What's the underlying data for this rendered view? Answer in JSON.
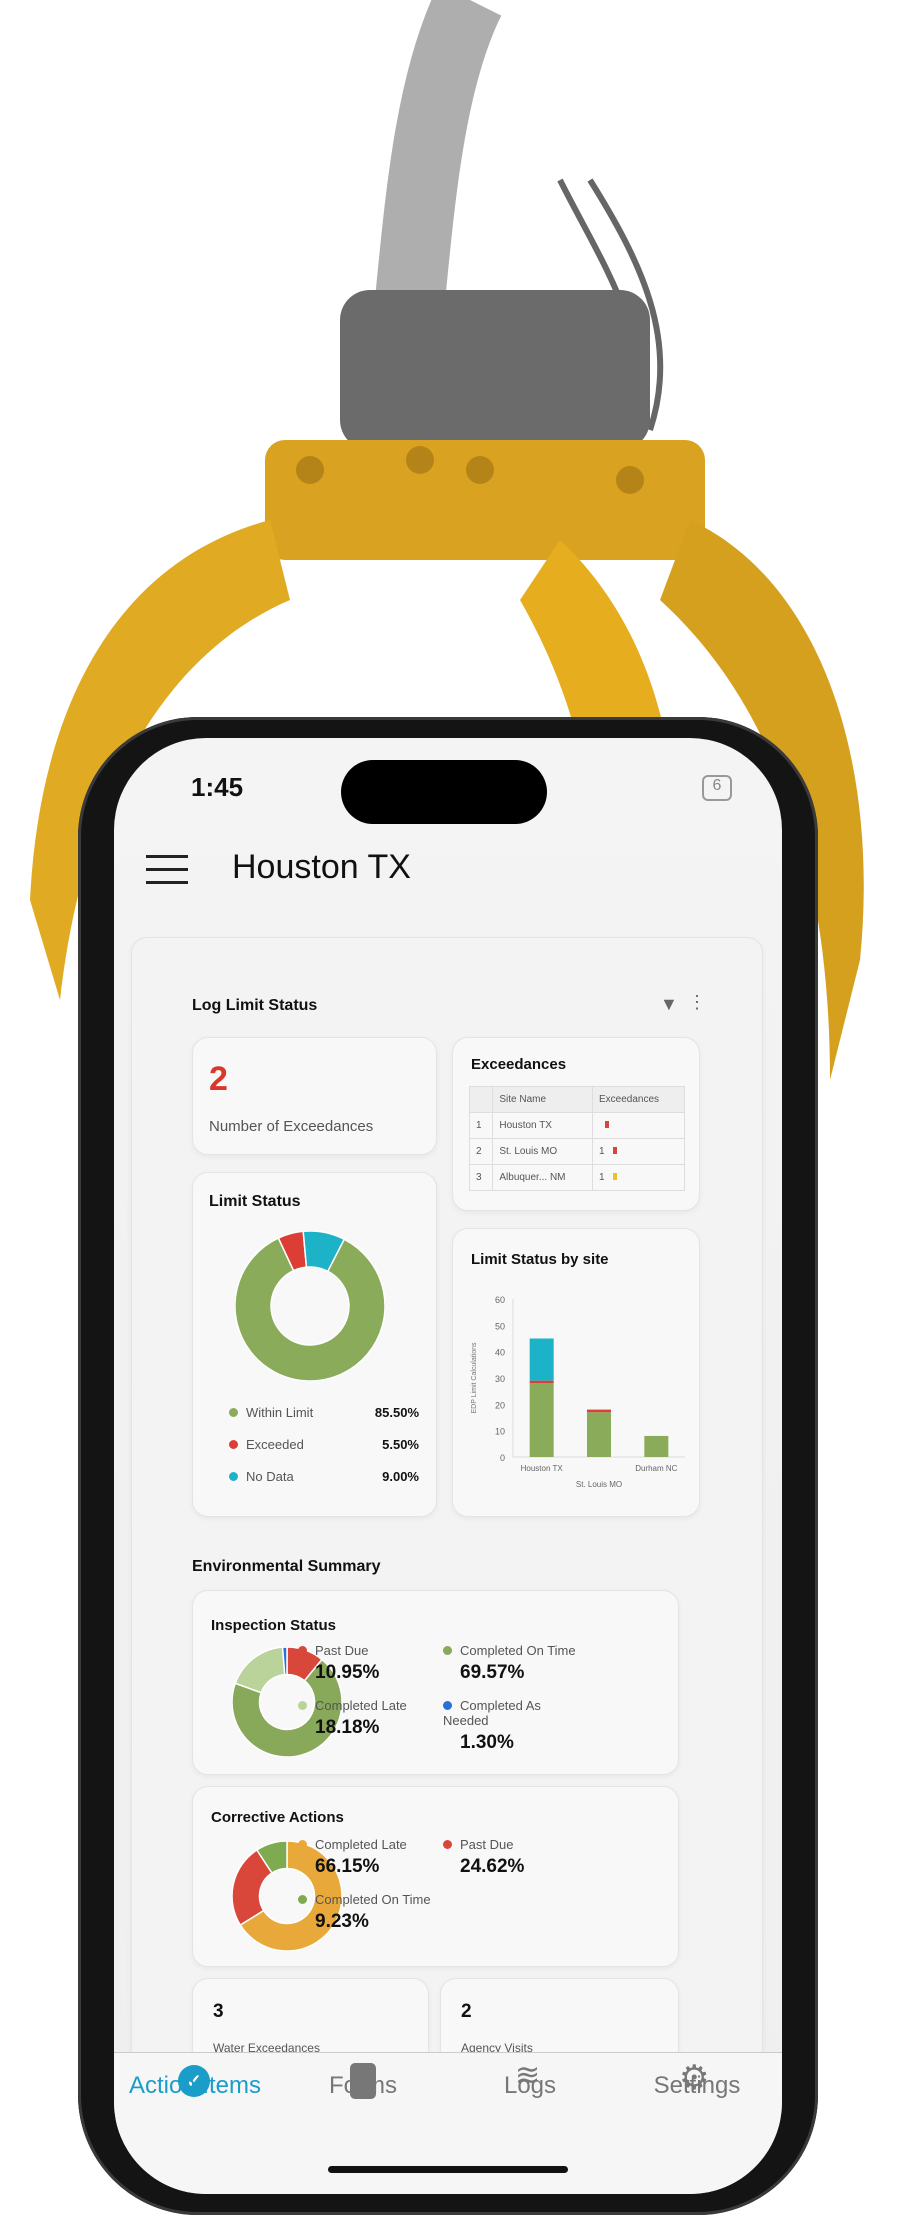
{
  "status_bar": {
    "time": "1:45",
    "battery": "6"
  },
  "header": {
    "title": "Houston TX"
  },
  "log_limit": {
    "title": "Log Limit Status",
    "exceed_count": "2",
    "exceed_label": "Number of Exceedances",
    "table": {
      "title": "Exceedances",
      "columns": [
        "",
        "Site Name",
        "Exceedances"
      ],
      "rows": [
        {
          "n": "1",
          "site": "Houston TX",
          "count": "",
          "color": "#d9453a"
        },
        {
          "n": "2",
          "site": "St. Louis MO",
          "count": "1",
          "color": "#d9453a"
        },
        {
          "n": "3",
          "site": "Albuquer... NM",
          "count": "1",
          "color": "#f0c020"
        }
      ]
    },
    "limit_status": {
      "title": "Limit Status",
      "items": [
        {
          "label": "Within Limit",
          "value": "85.50%",
          "pct": 85.5,
          "color": "#8aab5a"
        },
        {
          "label": "Exceeded",
          "value": "5.50%",
          "pct": 5.5,
          "color": "#dc3e35"
        },
        {
          "label": "No Data",
          "value": "9.00%",
          "pct": 9.0,
          "color": "#1cb3c9"
        }
      ]
    }
  },
  "chart_data": {
    "type": "bar",
    "title": "Limit Status by site",
    "ylabel": "EDP Limit Calculations",
    "ylim": [
      0,
      60
    ],
    "yticks": [
      "0",
      "10",
      "20",
      "30",
      "40",
      "50",
      "60"
    ],
    "categories": [
      "Houston TX",
      "St. Louis MO",
      "Durham NC"
    ],
    "series": [
      {
        "values": [
          28,
          17,
          8
        ],
        "color": "#8aab5a"
      },
      {
        "values": [
          1,
          1,
          0
        ],
        "color": "#dc3e35"
      },
      {
        "values": [
          16,
          0,
          0
        ],
        "color": "#1cb3c9"
      }
    ]
  },
  "env": {
    "title": "Environmental Summary",
    "inspection": {
      "title": "Inspection Status",
      "items": [
        {
          "label": "Past Due",
          "value": "10.95%",
          "pct": 10.95,
          "color": "#d9473b"
        },
        {
          "label": "Completed On Time",
          "value": "69.57%",
          "pct": 69.57,
          "color": "#88a85a"
        },
        {
          "label": "Completed Late",
          "value": "18.18%",
          "pct": 18.18,
          "color": "#b9d39a"
        },
        {
          "label": "Completed As Needed",
          "value": "1.30%",
          "pct": 1.3,
          "color": "#2d6fd9"
        }
      ]
    },
    "corrective": {
      "title": "Corrective Actions",
      "items": [
        {
          "label": "Completed Late",
          "value": "66.15%",
          "pct": 66.15,
          "color": "#e8a93a"
        },
        {
          "label": "Past Due",
          "value": "24.62%",
          "pct": 24.62,
          "color": "#d9473b"
        },
        {
          "label": "Completed On Time",
          "value": "9.23%",
          "pct": 9.23,
          "color": "#7eab4f"
        }
      ]
    },
    "water": {
      "value": "3",
      "label": "Water Exceedances"
    },
    "agency": {
      "value": "2",
      "label": "Agency Visits"
    }
  },
  "nav": {
    "items": [
      {
        "label": "Action Items",
        "icon": "check-circle-icon"
      },
      {
        "label": "Forms",
        "icon": "clipboard-icon"
      },
      {
        "label": "Logs",
        "icon": "layers-icon"
      },
      {
        "label": "Settings",
        "icon": "gear-icon"
      }
    ],
    "active_color": "#1a9dc8"
  }
}
